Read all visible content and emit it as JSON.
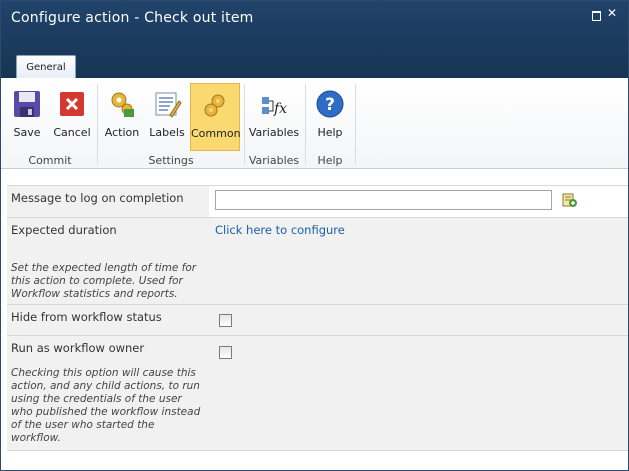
{
  "window": {
    "title": "Configure action - Check out item"
  },
  "tabs": [
    {
      "label": "General"
    }
  ],
  "ribbon": {
    "buttons": [
      {
        "label": "Save",
        "icon": "save-icon"
      },
      {
        "label": "Cancel",
        "icon": "cancel-icon"
      },
      {
        "label": "Action",
        "icon": "action-gears-icon"
      },
      {
        "label": "Labels",
        "icon": "labels-icon"
      },
      {
        "label": "Common",
        "icon": "common-gears-icon",
        "active": true
      },
      {
        "label": "Variables",
        "icon": "variables-fx-icon"
      },
      {
        "label": "Help",
        "icon": "help-icon"
      }
    ],
    "groups": [
      {
        "label": "Commit"
      },
      {
        "label": "Settings"
      },
      {
        "label": "Variables"
      },
      {
        "label": "Help"
      }
    ]
  },
  "form": {
    "message": {
      "label": "Message to log on completion",
      "value": ""
    },
    "duration": {
      "label": "Expected duration",
      "link": "Click here to configure",
      "description": "Set the expected length of time for this action to complete. Used for Workflow statistics and reports."
    },
    "hide": {
      "label": "Hide from workflow status",
      "checked": false
    },
    "owner": {
      "label": "Run as workflow owner",
      "checked": false,
      "description": "Checking this option will cause this action, and any child actions, to run using the credentials of the user who published the workflow instead of the user who started the workflow."
    }
  },
  "colors": {
    "titlebar": "#1d3d62",
    "active_button": "#fbd971",
    "link": "#1a5fa8"
  }
}
